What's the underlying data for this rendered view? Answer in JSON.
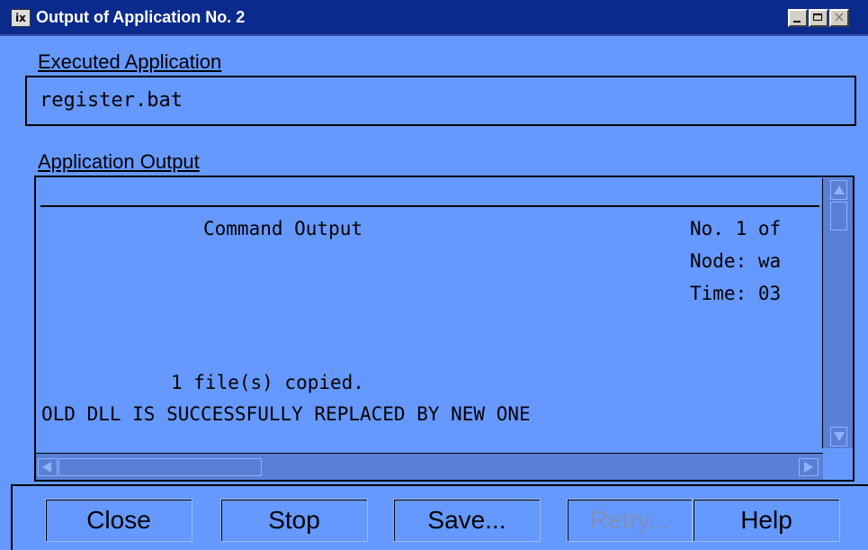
{
  "window": {
    "title": "Output of Application No. 2",
    "icon": "app-icon",
    "title_icon_glyph": "ix",
    "controls": [
      "minimize-icon",
      "maximize-icon",
      "close-icon"
    ]
  },
  "executed_application": {
    "label": "Executed Application",
    "value": "register.bat"
  },
  "application_output": {
    "label": "Application Output",
    "lines": {
      "header": "Command Output",
      "no": "No. 1 of",
      "node": "Node: wa",
      "time": "Time: 03",
      "copied": "1 file(s) copied.",
      "result": "OLD DLL IS SUCCESSFULLY REPLACED BY NEW ONE"
    }
  },
  "buttons": {
    "close": "Close",
    "stop": "Stop",
    "save": "Save...",
    "retry": "Retry...",
    "help": "Help"
  },
  "colors": {
    "background": "#6699ff",
    "titlebar": "#0a2a8c",
    "disabled_text": "#7d8fb8"
  }
}
